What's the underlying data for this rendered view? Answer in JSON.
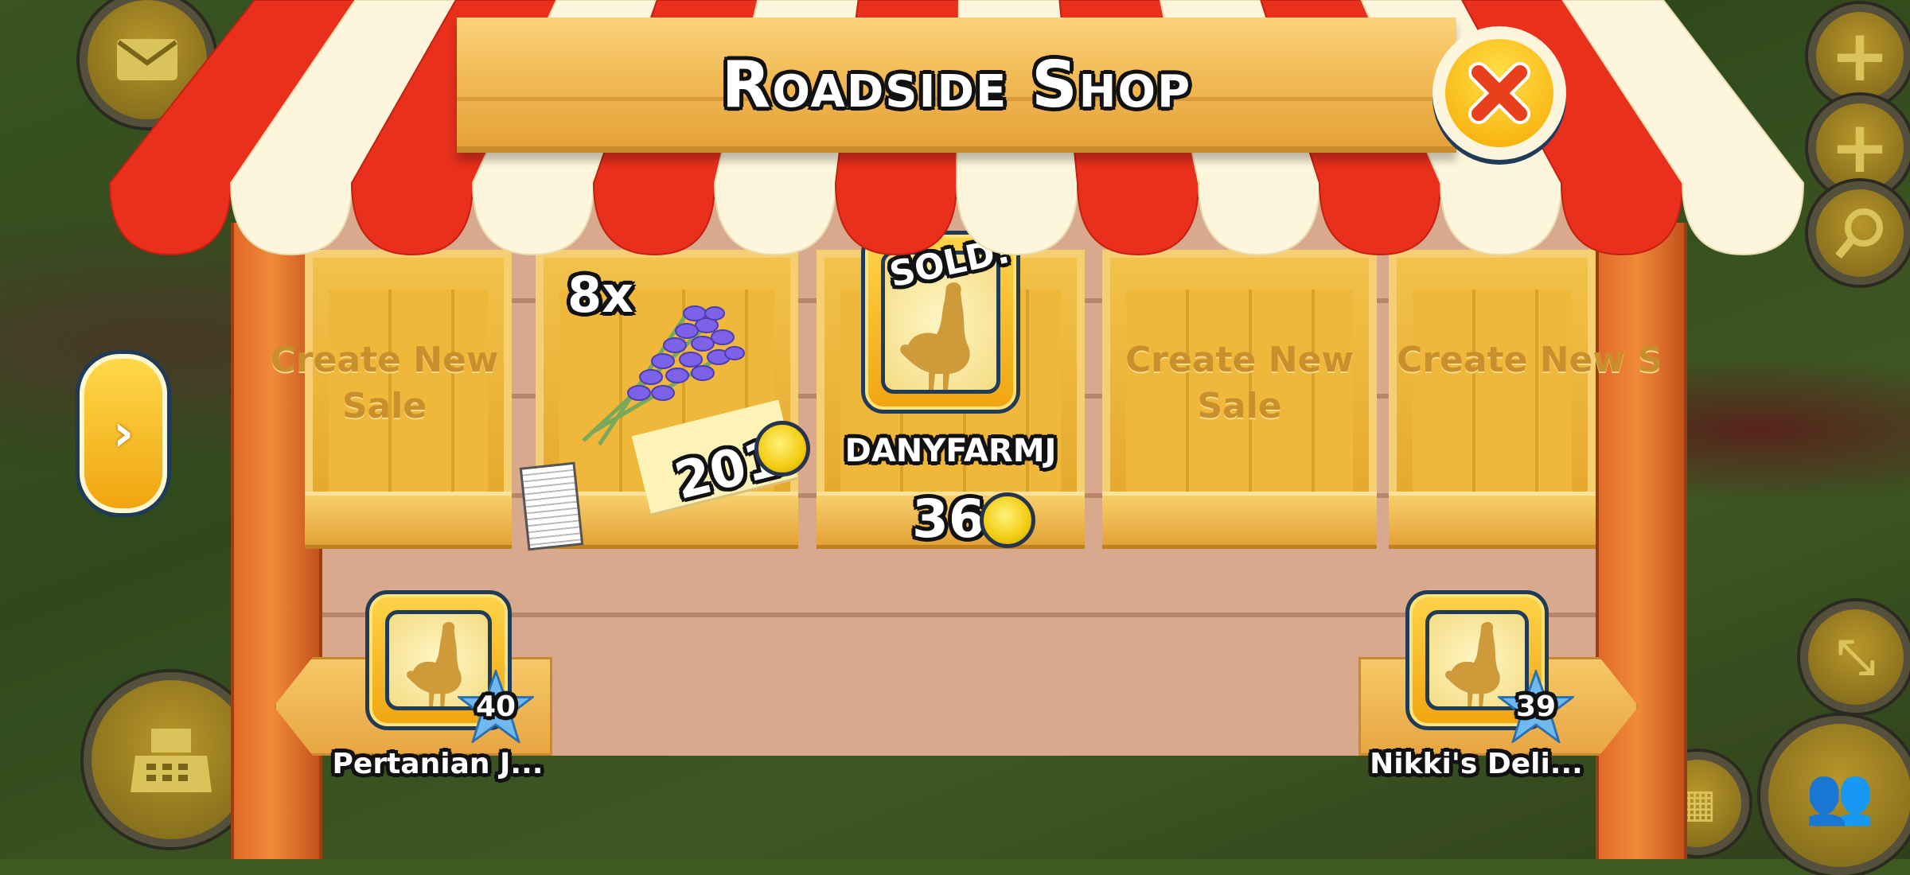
{
  "title": "Roadside Shop",
  "close_icon": "close-x-icon",
  "colors": {
    "awning_red": "#e8301c",
    "awning_white": "#fdf6dc",
    "banner": "#f5c563",
    "coin": "#f2cc10",
    "create_text": "#c98f2c"
  },
  "slots": [
    {
      "type": "empty",
      "label": "Create New Sale"
    },
    {
      "type": "selling",
      "quantity": "8x",
      "item": "lavender",
      "price": "201",
      "ad_icon": "newspaper-icon"
    },
    {
      "type": "sold",
      "badge": "SOLD!",
      "buyer": "DANYFARMJ",
      "price": "36"
    },
    {
      "type": "empty",
      "label": "Create New Sale"
    },
    {
      "type": "empty",
      "label": "Create New Sale"
    }
  ],
  "friends": [
    {
      "name": "Pertanian J...",
      "level": "40"
    },
    {
      "name": "Nikki's Deli...",
      "level": "39"
    }
  ],
  "hud": {
    "left": [
      "mail-icon",
      "cash-register-icon"
    ],
    "right": [
      "plus-icon",
      "plus-icon",
      "magnifier-icon",
      "expand-icon",
      "friends-icon"
    ]
  }
}
